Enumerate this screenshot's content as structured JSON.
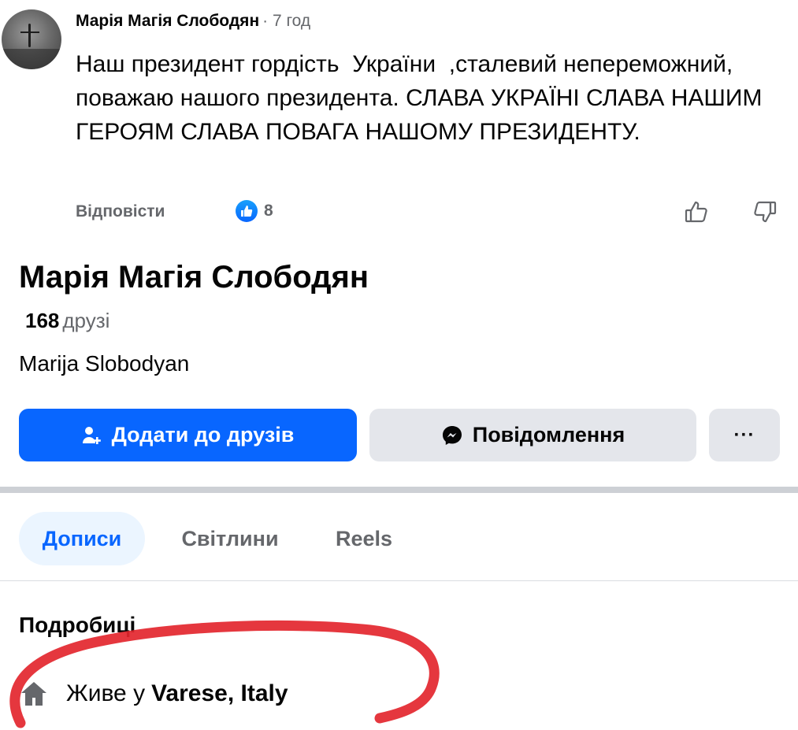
{
  "comment": {
    "author": "Марія Магія Слободян",
    "time": "· 7 год",
    "text": "Наш президент гордість  України  ,сталевий непереможний, поважаю нашого президента. СЛАВА УКРАЇНІ СЛАВА НАШИМ ГЕРОЯМ СЛАВА ПОВАГА НАШОМУ ПРЕЗИДЕНТУ.",
    "reply_label": "Відповісти",
    "like_count": "8",
    "icons": {
      "like_badge": "thumbs-up-icon",
      "upvote": "thumb-up-outline-icon",
      "downvote": "thumb-down-outline-icon"
    }
  },
  "profile": {
    "name": "Марія Магія Слободян",
    "friends_count": "168",
    "friends_label": "друзі",
    "alt_name": "Marija Slobodyan",
    "buttons": {
      "add_friend": "Додати до друзів",
      "message": "Повідомлення",
      "more": "···"
    },
    "tabs": [
      {
        "label": "Дописи",
        "active": true
      },
      {
        "label": "Світлини",
        "active": false
      },
      {
        "label": "Reels",
        "active": false
      }
    ],
    "details_title": "Подробиці",
    "lives_prefix": "Живе у",
    "lives_place": "Varese, Italy"
  },
  "colors": {
    "accent": "#0866ff",
    "secondary_button": "#e4e6eb",
    "muted_text": "#65676b",
    "annotation": "#e3262e"
  }
}
